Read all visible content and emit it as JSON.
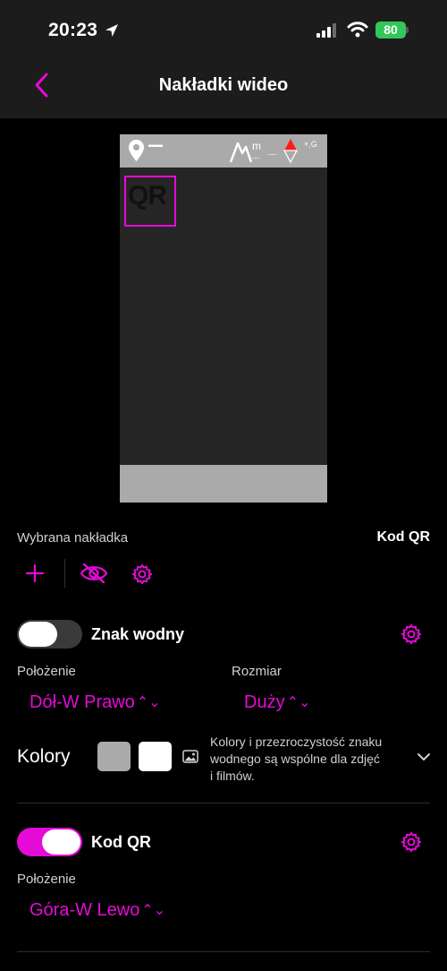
{
  "status": {
    "time": "20:23",
    "battery": "80"
  },
  "nav": {
    "title": "Nakładki wideo"
  },
  "preview": {
    "qr_label": "QR",
    "alt_unit": "m",
    "alt_value": "---",
    "g_label": "+,G"
  },
  "selected": {
    "label": "Wybrana nakładka",
    "value": "Kod QR"
  },
  "watermark": {
    "title": "Znak wodny",
    "enabled": false,
    "position_label": "Położenie",
    "position_value": "Dół-W Prawo",
    "size_label": "Rozmiar",
    "size_value": "Duży",
    "colors_label": "Kolory",
    "colors": [
      "#aaaaaa",
      "#ffffff"
    ],
    "note_line1": "Kolory i przezroczystość znaku",
    "note_line2": "wodnego są wspólne dla zdjęć",
    "note_line3": "i filmów."
  },
  "qr": {
    "title": "Kod QR",
    "enabled": true,
    "position_label": "Położenie",
    "position_value": "Góra-W Lewo"
  },
  "accent": "#e60ad9",
  "icons": [
    "location-arrow-icon",
    "signal-icon",
    "wifi-icon",
    "back-chevron-icon",
    "map-pin-icon",
    "mountain-icon",
    "compass-icon",
    "plus-icon",
    "eye-slash-icon",
    "gear-icon",
    "image-icon",
    "chevron-down-icon",
    "chevron-updown-icon"
  ]
}
